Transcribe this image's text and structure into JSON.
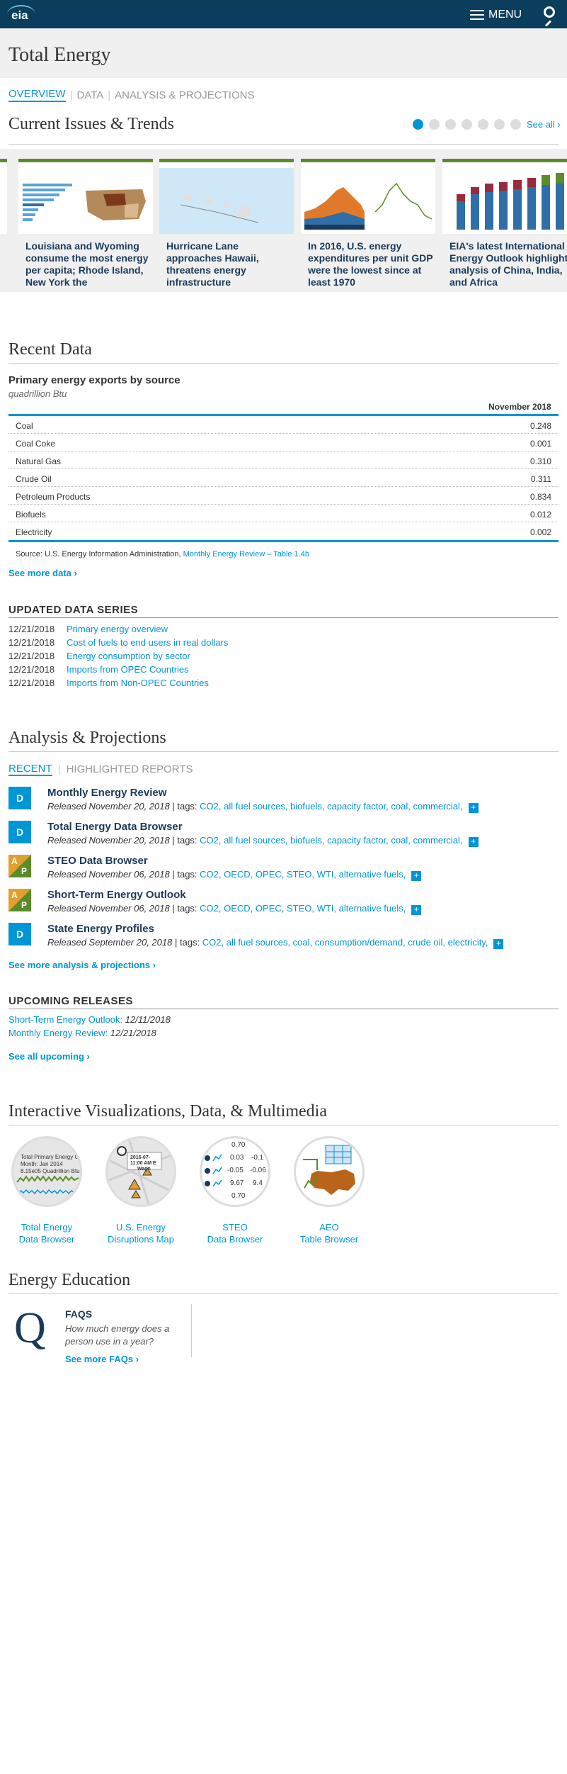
{
  "header": {
    "logo_text": "eia",
    "menu_label": "MENU"
  },
  "page": {
    "title": "Total Energy",
    "tabs": [
      "OVERVIEW",
      "DATA",
      "ANALYSIS & PROJECTIONS"
    ]
  },
  "current_issues": {
    "heading": "Current Issues & Trends",
    "see_all": "See all ›",
    "cards": [
      {
        "caption": "Louisiana and Wyoming consume the most energy per capita; Rhode Island, New York the"
      },
      {
        "caption": "Hurricane Lane approaches Hawaii, threatens energy infrastructure"
      },
      {
        "caption": "In 2016, U.S. energy expenditures per unit GDP were the lowest since at least 1970"
      },
      {
        "caption": "EIA's latest International Energy Outlook highlights analysis of China, India, and Africa"
      }
    ]
  },
  "recent_data": {
    "heading": "Recent Data",
    "table_title": "Primary energy exports by source",
    "units": "quadrillion Btu",
    "column_header": "November 2018",
    "rows": [
      {
        "label": "Coal",
        "value": "0.248"
      },
      {
        "label": "Coal Coke",
        "value": "0.001"
      },
      {
        "label": "Natural Gas",
        "value": "0.310"
      },
      {
        "label": "Crude Oil",
        "value": "0.311"
      },
      {
        "label": "Petroleum Products",
        "value": "0.834"
      },
      {
        "label": "Biofuels",
        "value": "0.012"
      },
      {
        "label": "Electricity",
        "value": "0.002"
      }
    ],
    "source_prefix": "Source: U.S. Energy Information Administration,",
    "source_link": "Monthly Energy Review – Table 1.4b",
    "see_more": "See more data ›"
  },
  "updated_series": {
    "heading": "UPDATED DATA SERIES",
    "items": [
      {
        "date": "12/21/2018",
        "label": "Primary energy overview"
      },
      {
        "date": "12/21/2018",
        "label": "Cost of fuels to end users in real dollars"
      },
      {
        "date": "12/21/2018",
        "label": "Energy consumption by sector"
      },
      {
        "date": "12/21/2018",
        "label": "Imports from OPEC Countries"
      },
      {
        "date": "12/21/2018",
        "label": "Imports from Non-OPEC Countries"
      }
    ]
  },
  "analysis": {
    "heading": "Analysis & Projections",
    "tabs": [
      "RECENT",
      "HIGHLIGHTED REPORTS"
    ],
    "tags_label": "| tags:",
    "reports": [
      {
        "badge": "D",
        "title": "Monthly Energy Review",
        "released": "Released November 20, 2018",
        "tags": "CO2, all fuel sources, biofuels, capacity factor, coal, commercial,"
      },
      {
        "badge": "D",
        "title": "Total Energy Data Browser",
        "released": "Released November 20, 2018",
        "tags": "CO2, all fuel sources, biofuels, capacity factor, coal, commercial,"
      },
      {
        "badge": "AP",
        "title": "STEO Data Browser",
        "released": "Released November 06, 2018",
        "tags": "CO2, OECD, OPEC, STEO, WTI, alternative fuels,"
      },
      {
        "badge": "AP",
        "title": "Short-Term Energy Outlook",
        "released": "Released November 06, 2018",
        "tags": "CO2, OECD, OPEC, STEO, WTI, alternative fuels,"
      },
      {
        "badge": "D",
        "title": "State Energy Profiles",
        "released": "Released September 20, 2018",
        "tags": "CO2, all fuel sources, coal, consumption/demand, crude oil, electricity,"
      }
    ],
    "see_more": "See more analysis & projections ›"
  },
  "upcoming": {
    "heading": "UPCOMING RELEASES",
    "items": [
      {
        "label": "Short-Term Energy Outlook:",
        "date": "12/11/2018"
      },
      {
        "label": "Monthly Energy Review:",
        "date": "12/21/2018"
      }
    ],
    "see_all": "See all upcoming ›"
  },
  "viz": {
    "heading": "Interactive Visualizations, Data, & Multimedia",
    "items": [
      {
        "line1": "Total Energy",
        "line2": "Data Browser",
        "thumb_title": "Total Primary Energy Co",
        "thumb_sub1": "Month: Jan 2014",
        "thumb_sub2": "8.15e05 Quadrillion Btu"
      },
      {
        "line1": "U.S. Energy",
        "line2": "Disruptions Map",
        "thumb_title": "2016-07-",
        "thumb_sub1": "11:00 AM E",
        "thumb_sub2": "Wagn"
      },
      {
        "line1": "STEO",
        "line2": "Data Browser",
        "thumb_values": [
          "0.70",
          "0.03",
          "-0.1",
          "-0.05",
          "-0.06",
          "9.67",
          "9.4",
          "0.70"
        ]
      },
      {
        "line1": "AEO",
        "line2": "Table Browser"
      }
    ]
  },
  "education": {
    "heading": "Energy Education",
    "faq_heading": "FAQS",
    "faq_question": "How much energy does a person use in a year?",
    "faq_link": "See more FAQs ›"
  }
}
